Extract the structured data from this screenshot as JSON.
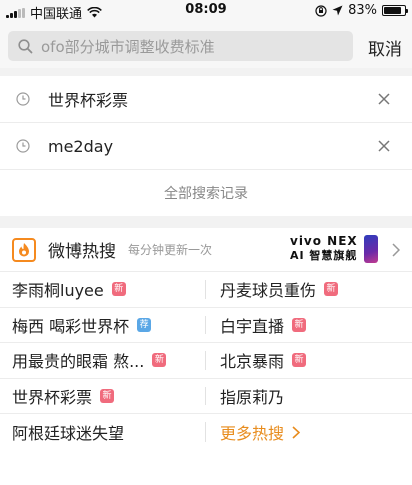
{
  "status_bar": {
    "carrier": "中国联通",
    "time": "08:09",
    "battery_text": "83%",
    "battery_level": 0.83
  },
  "search": {
    "placeholder": "ofo部分城市调整收费标准",
    "cancel_label": "取消"
  },
  "history": {
    "items": [
      {
        "text": "世界杯彩票"
      },
      {
        "text": "me2day"
      }
    ],
    "all_label": "全部搜索记录"
  },
  "hot": {
    "title": "微博热搜",
    "subtitle": "每分钟更新一次",
    "ad": {
      "brand": "vivo NEX",
      "tagline": "AI 智慧旗舰"
    },
    "items": [
      {
        "text": "李雨桐luyee",
        "badge": "新",
        "badge_type": "new"
      },
      {
        "text": "丹麦球员重伤",
        "badge": "新",
        "badge_type": "new"
      },
      {
        "text": "梅西 喝彩世界杯",
        "badge": "荐",
        "badge_type": "rec"
      },
      {
        "text": "白宇直播",
        "badge": "新",
        "badge_type": "new"
      },
      {
        "text": "用最贵的眼霜 熬...",
        "badge": "新",
        "badge_type": "new"
      },
      {
        "text": "北京暴雨",
        "badge": "新",
        "badge_type": "new"
      },
      {
        "text": "世界杯彩票",
        "badge": "新",
        "badge_type": "new"
      },
      {
        "text": "指原莉乃",
        "badge": "",
        "badge_type": ""
      },
      {
        "text": "阿根廷球迷失望",
        "badge": "",
        "badge_type": ""
      }
    ],
    "more_label": "更多热搜"
  },
  "colors": {
    "accent_orange": "#e88c1d",
    "badge_new": "#f06b7d",
    "badge_rec": "#5aa7e6"
  }
}
